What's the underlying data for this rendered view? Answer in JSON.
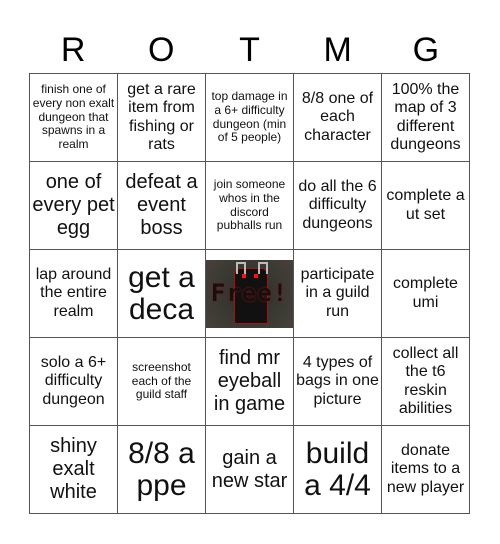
{
  "header": {
    "letters": [
      "R",
      "O",
      "T",
      "M",
      "G"
    ]
  },
  "free_space": {
    "label": "Free!",
    "icon": "free-space-pixel-art"
  },
  "cells": [
    {
      "text": "finish one of every non exalt dungeon that spawns in a realm",
      "size": "s"
    },
    {
      "text": "get a rare item from fishing or rats",
      "size": "m"
    },
    {
      "text": "top damage in a 6+ difficulty dungeon (min of 5 people)",
      "size": "s"
    },
    {
      "text": "8/8 one of each character",
      "size": "m"
    },
    {
      "text": "100% the map of 3 different dungeons",
      "size": "m"
    },
    {
      "text": "one of every pet egg",
      "size": "l"
    },
    {
      "text": "defeat a event boss",
      "size": "l"
    },
    {
      "text": "join someone whos in the discord pubhalls run",
      "size": "s"
    },
    {
      "text": "do all the 6 difficulty dungeons",
      "size": "m"
    },
    {
      "text": "complete a ut set",
      "size": "m"
    },
    {
      "text": "lap around the entire realm",
      "size": "m"
    },
    {
      "text": "get a deca",
      "size": "xl"
    },
    {
      "text": "Free!",
      "size": "free"
    },
    {
      "text": "participate in a guild run",
      "size": "m"
    },
    {
      "text": "complete umi",
      "size": "m"
    },
    {
      "text": "solo a 6+ difficulty dungeon",
      "size": "m"
    },
    {
      "text": "screenshot each of the guild staff",
      "size": "s"
    },
    {
      "text": "find mr eyeball in game",
      "size": "l"
    },
    {
      "text": "4 types of bags in one picture",
      "size": "m"
    },
    {
      "text": "collect all the t6 reskin abilities",
      "size": "m"
    },
    {
      "text": "shiny exalt white",
      "size": "l"
    },
    {
      "text": "8/8 a ppe",
      "size": "xl"
    },
    {
      "text": "gain a new star",
      "size": "l"
    },
    {
      "text": "build a 4/4",
      "size": "xl"
    },
    {
      "text": "donate items to a new player",
      "size": "m"
    }
  ]
}
